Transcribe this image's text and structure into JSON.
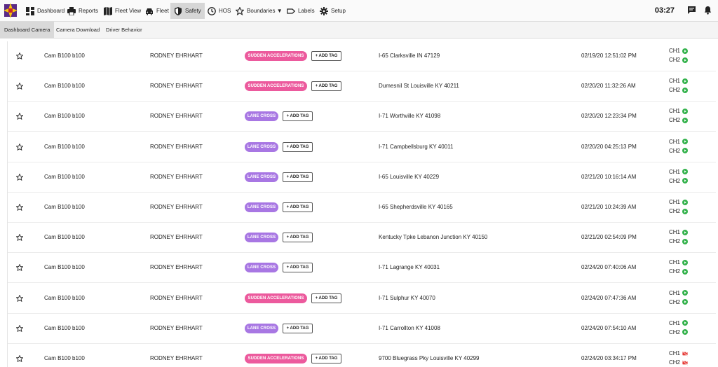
{
  "nav": {
    "items": [
      {
        "label": "Dashboard",
        "icon": "dashboard-icon"
      },
      {
        "label": "Reports",
        "icon": "printer-icon"
      },
      {
        "label": "Fleet View",
        "icon": "map-icon"
      },
      {
        "label": "Fleet",
        "icon": "car-icon"
      },
      {
        "label": "Safety",
        "icon": "shield-icon"
      },
      {
        "label": "HOS",
        "icon": "clock-icon"
      },
      {
        "label": "Boundaries ▼",
        "icon": "star-icon"
      },
      {
        "label": "Labels",
        "icon": "label-icon"
      },
      {
        "label": "Setup",
        "icon": "gear-icon"
      }
    ],
    "active_index": 4,
    "clock": "03:27"
  },
  "subnav": {
    "items": [
      "Dashboard Camera",
      "Camera Download",
      "Driver Behavior"
    ],
    "active_index": 0
  },
  "colors": {
    "sudden": "#ec5a9d",
    "lane": "#a877e3",
    "play_green": "#34b24c",
    "unavailable_red": "#e53935"
  },
  "table": {
    "add_tag_label": "+ ADD TAG",
    "ch1_label": "CH1",
    "ch2_label": "CH2",
    "rows": [
      {
        "camera": "Cam B100 b100",
        "driver": "RODNEY EHRHART",
        "event": "SUDDEN ACCELERATIONS",
        "event_type": "sudden",
        "location": "I-65 Clarksville IN 47129",
        "datetime": "02/19/20 12:51:02 PM",
        "ch1_status": "play",
        "ch2_status": "play"
      },
      {
        "camera": "Cam B100 b100",
        "driver": "RODNEY EHRHART",
        "event": "SUDDEN ACCELERATIONS",
        "event_type": "sudden",
        "location": "Dumesnil St Louisville KY 40211",
        "datetime": "02/20/20 11:32:26 AM",
        "ch1_status": "play",
        "ch2_status": "play"
      },
      {
        "camera": "Cam B100 b100",
        "driver": "RODNEY EHRHART",
        "event": "LANE CROSS",
        "event_type": "lane",
        "location": "I-71 Worthville KY 41098",
        "datetime": "02/20/20 12:23:34 PM",
        "ch1_status": "play",
        "ch2_status": "play"
      },
      {
        "camera": "Cam B100 b100",
        "driver": "RODNEY EHRHART",
        "event": "LANE CROSS",
        "event_type": "lane",
        "location": "I-71 Campbellsburg KY 40011",
        "datetime": "02/20/20 04:25:13 PM",
        "ch1_status": "play",
        "ch2_status": "play"
      },
      {
        "camera": "Cam B100 b100",
        "driver": "RODNEY EHRHART",
        "event": "LANE CROSS",
        "event_type": "lane",
        "location": "I-65 Louisville KY 40229",
        "datetime": "02/21/20 10:16:14 AM",
        "ch1_status": "play",
        "ch2_status": "play"
      },
      {
        "camera": "Cam B100 b100",
        "driver": "RODNEY EHRHART",
        "event": "LANE CROSS",
        "event_type": "lane",
        "location": "I-65 Shepherdsville KY 40165",
        "datetime": "02/21/20 10:24:39 AM",
        "ch1_status": "play",
        "ch2_status": "play"
      },
      {
        "camera": "Cam B100 b100",
        "driver": "RODNEY EHRHART",
        "event": "LANE CROSS",
        "event_type": "lane",
        "location": "Kentucky Tpke Lebanon Junction KY 40150",
        "datetime": "02/21/20 02:54:09 PM",
        "ch1_status": "play",
        "ch2_status": "play"
      },
      {
        "camera": "Cam B100 b100",
        "driver": "RODNEY EHRHART",
        "event": "LANE CROSS",
        "event_type": "lane",
        "location": "I-71 Lagrange KY 40031",
        "datetime": "02/24/20 07:40:06 AM",
        "ch1_status": "play",
        "ch2_status": "play"
      },
      {
        "camera": "Cam B100 b100",
        "driver": "RODNEY EHRHART",
        "event": "SUDDEN ACCELERATIONS",
        "event_type": "sudden",
        "location": "I-71 Sulphur KY 40070",
        "datetime": "02/24/20 07:47:36 AM",
        "ch1_status": "play",
        "ch2_status": "play"
      },
      {
        "camera": "Cam B100 b100",
        "driver": "RODNEY EHRHART",
        "event": "LANE CROSS",
        "event_type": "lane",
        "location": "I-71 Carrollton KY 41008",
        "datetime": "02/24/20 07:54:10 AM",
        "ch1_status": "play",
        "ch2_status": "play"
      },
      {
        "camera": "Cam B100 b100",
        "driver": "RODNEY EHRHART",
        "event": "SUDDEN ACCELERATIONS",
        "event_type": "sudden",
        "location": "9700 Bluegrass Pky Louisville KY 40299",
        "datetime": "02/24/20 03:34:17 PM",
        "ch1_status": "unavailable",
        "ch2_status": "unavailable"
      }
    ]
  }
}
